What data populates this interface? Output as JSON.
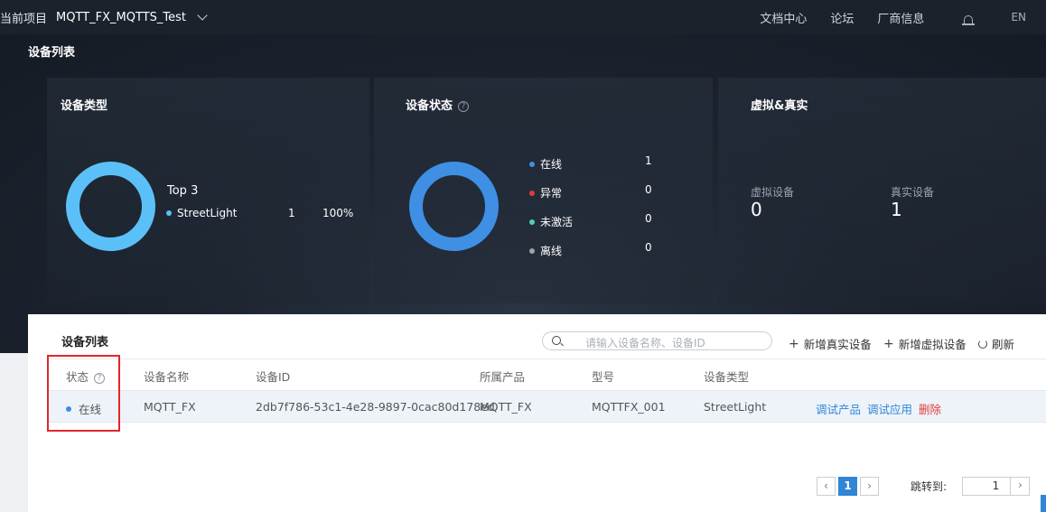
{
  "topbar": {
    "project_label": "当前项目",
    "project_name": "MQTT_FX_MQTTS_Test",
    "nav": [
      "文档中心",
      "论坛",
      "厂商信息"
    ],
    "lang": "EN"
  },
  "hero": {
    "title": "设备列表",
    "device_type": {
      "title": "设备类型",
      "top_label": "Top 3",
      "items": [
        {
          "name": "StreetLight",
          "count": "1",
          "percent": "100%",
          "color": "#5bc0f8"
        }
      ]
    },
    "device_status": {
      "title": "设备状态",
      "items": [
        {
          "name": "在线",
          "count": "1",
          "color": "#3f8fe4"
        },
        {
          "name": "异常",
          "count": "0",
          "color": "#e23b3b"
        },
        {
          "name": "未激活",
          "count": "0",
          "color": "#4fd1b8"
        },
        {
          "name": "离线",
          "count": "0",
          "color": "#9aa3ae"
        }
      ]
    },
    "virtual_real": {
      "title": "虚拟&真实",
      "virtual_label": "虚拟设备",
      "virtual_value": "0",
      "real_label": "真实设备",
      "real_value": "1"
    }
  },
  "list": {
    "title": "设备列表",
    "search_placeholder": "请输入设备名称、设备ID",
    "add_real": "新增真实设备",
    "add_virtual": "新增虚拟设备",
    "refresh": "刷新",
    "columns": [
      "状态",
      "设备名称",
      "设备ID",
      "所属产品",
      "型号",
      "设备类型"
    ],
    "rows": [
      {
        "status": "在线",
        "name": "MQTT_FX",
        "id": "2db7f786-53c1-4e28-9897-0cac80d178ed",
        "product": "MQTT_FX",
        "model": "MQTTFX_001",
        "type": "StreetLight",
        "actions": [
          "调试产品",
          "调试应用",
          "删除"
        ]
      }
    ]
  },
  "pagination": {
    "current_page": "1",
    "jump_label": "跳转到:",
    "jump_value": "1"
  }
}
